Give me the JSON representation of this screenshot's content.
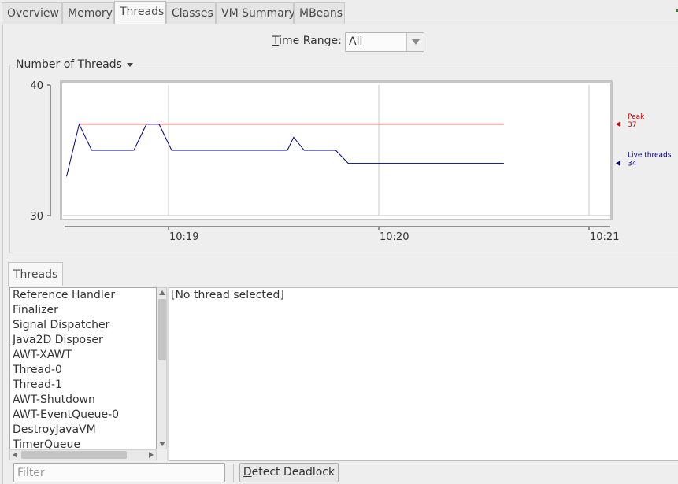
{
  "tabs": [
    {
      "label": "Overview",
      "active": false
    },
    {
      "label": "Memory",
      "active": false
    },
    {
      "label": "Threads",
      "active": true
    },
    {
      "label": "Classes",
      "active": false
    },
    {
      "label": "VM Summary",
      "active": false
    },
    {
      "label": "MBeans",
      "active": false
    }
  ],
  "time_range": {
    "label_mnemonic": "T",
    "label_rest": "ime Range:",
    "selected": "All"
  },
  "chart_panel": {
    "title": "Number of Threads"
  },
  "chart_data": {
    "type": "line",
    "ylim": [
      30,
      40
    ],
    "y_ticks": [
      "40",
      "30"
    ],
    "x_ticks": [
      "10:19",
      "10:20",
      "10:21"
    ],
    "series": [
      {
        "name": "Live threads",
        "color": "#000080",
        "points": [
          [
            0.0,
            33
          ],
          [
            0.06,
            37
          ],
          [
            0.12,
            35
          ],
          [
            0.32,
            35
          ],
          [
            0.38,
            37
          ],
          [
            0.44,
            37
          ],
          [
            0.5,
            35
          ],
          [
            1.0,
            35
          ],
          [
            1.05,
            35
          ],
          [
            1.08,
            36
          ],
          [
            1.13,
            35
          ],
          [
            1.28,
            35
          ],
          [
            1.34,
            34
          ],
          [
            2.08,
            34
          ]
        ],
        "last_value": "34"
      },
      {
        "name": "Peak",
        "color": "#cc0000",
        "points": [
          [
            0.06,
            37
          ],
          [
            2.08,
            37
          ]
        ],
        "last_value": "37"
      }
    ]
  },
  "threads_section": {
    "tab_label": "Threads",
    "threads": [
      "Reference Handler",
      "Finalizer",
      "Signal Dispatcher",
      "Java2D Disposer",
      "AWT-XAWT",
      "Thread-0",
      "Thread-1",
      "AWT-Shutdown",
      "AWT-EventQueue-0",
      "DestroyJavaVM",
      "TimerQueue"
    ],
    "detail_text": "[No thread selected]",
    "filter_placeholder": "Filter",
    "detect_deadlock_mnemonic": "D",
    "detect_deadlock_rest": "etect Deadlock"
  }
}
